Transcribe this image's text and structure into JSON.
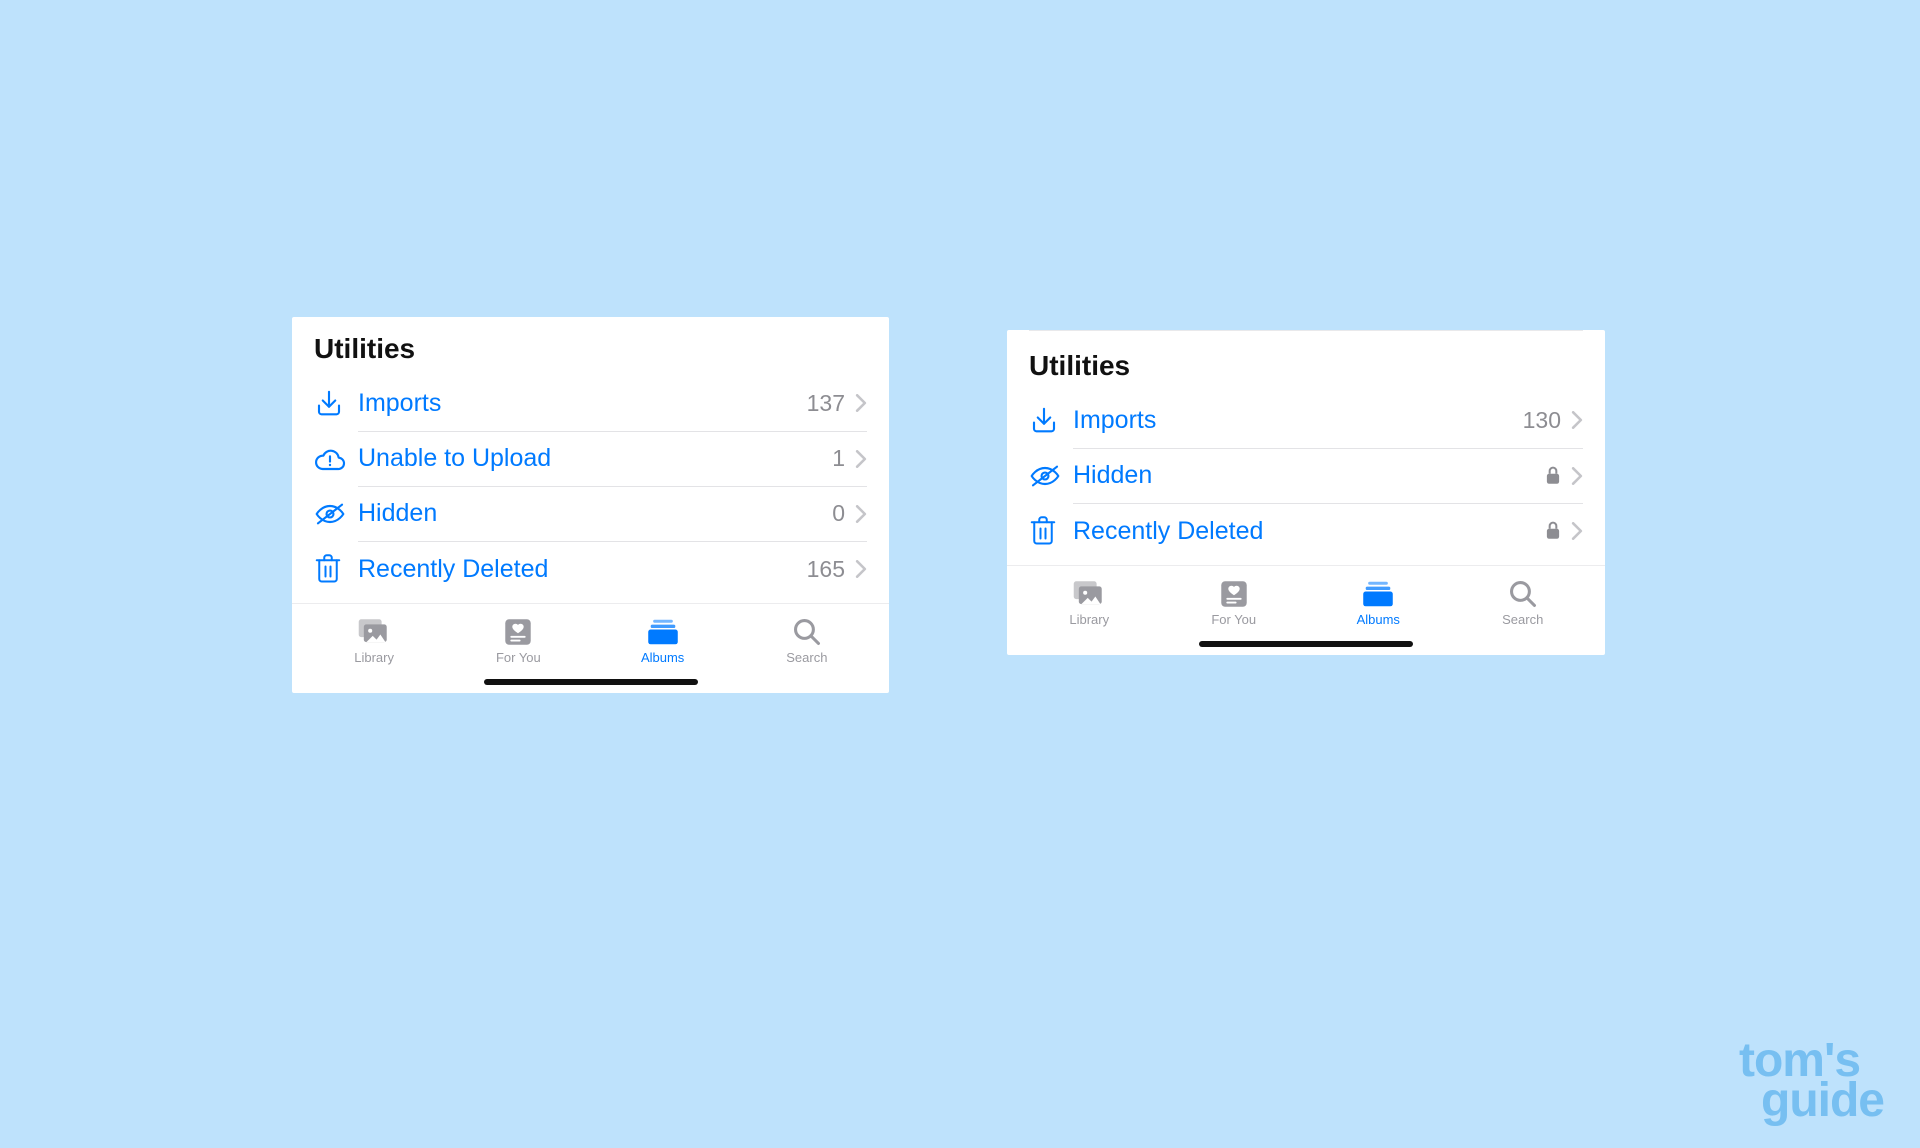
{
  "left_panel": {
    "title": "Utilities",
    "items": [
      {
        "icon": "import",
        "label": "Imports",
        "count": "137",
        "locked": false
      },
      {
        "icon": "cloud-alert",
        "label": "Unable to Upload",
        "count": "1",
        "locked": false
      },
      {
        "icon": "eye-off",
        "label": "Hidden",
        "count": "0",
        "locked": false
      },
      {
        "icon": "trash",
        "label": "Recently Deleted",
        "count": "165",
        "locked": false
      }
    ],
    "tabs": [
      {
        "icon": "library",
        "label": "Library",
        "active": false
      },
      {
        "icon": "for-you",
        "label": "For You",
        "active": false
      },
      {
        "icon": "albums",
        "label": "Albums",
        "active": true
      },
      {
        "icon": "search",
        "label": "Search",
        "active": false
      }
    ]
  },
  "right_panel": {
    "title": "Utilities",
    "items": [
      {
        "icon": "import",
        "label": "Imports",
        "count": "130",
        "locked": false
      },
      {
        "icon": "eye-off",
        "label": "Hidden",
        "count": "",
        "locked": true
      },
      {
        "icon": "trash",
        "label": "Recently Deleted",
        "count": "",
        "locked": true
      }
    ],
    "tabs": [
      {
        "icon": "library",
        "label": "Library",
        "active": false
      },
      {
        "icon": "for-you",
        "label": "For You",
        "active": false
      },
      {
        "icon": "albums",
        "label": "Albums",
        "active": true
      },
      {
        "icon": "search",
        "label": "Search",
        "active": false
      }
    ]
  },
  "watermark": {
    "line1": "tom's",
    "line2": "guide"
  }
}
